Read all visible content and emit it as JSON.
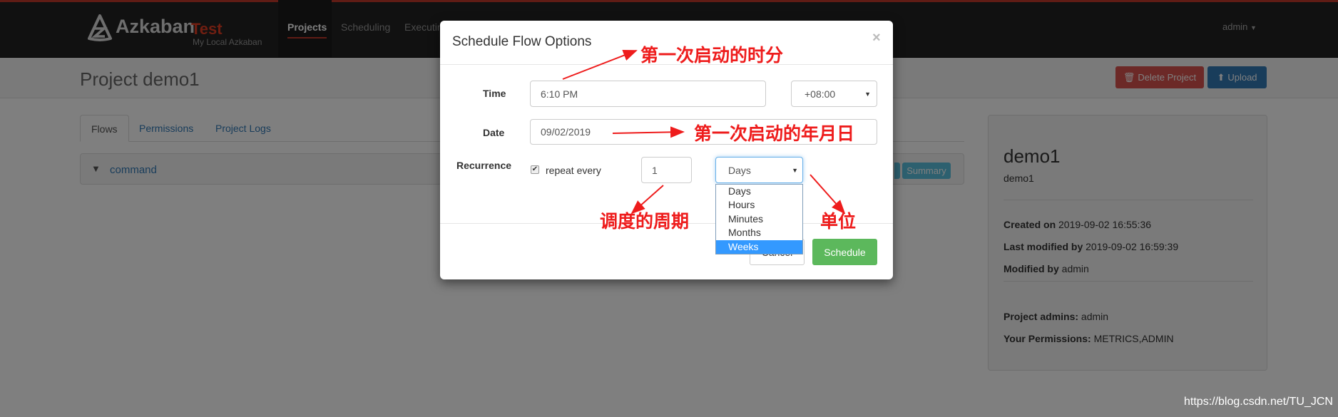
{
  "navbar": {
    "brand": "Azkaban",
    "env": "Test",
    "subtitle": "My Local Azkaban",
    "items": [
      {
        "label": "Projects",
        "active": true
      },
      {
        "label": "Scheduling"
      },
      {
        "label": "Executing"
      }
    ],
    "user": "admin"
  },
  "page": {
    "title": "Project demo1",
    "delete_label": "Delete Project",
    "upload_label": "Upload",
    "tabs": [
      {
        "label": "Flows",
        "active": true
      },
      {
        "label": "Permissions"
      },
      {
        "label": "Project Logs"
      }
    ],
    "flow": {
      "name": "command",
      "summary_label": "Summary"
    }
  },
  "project_info": {
    "name": "demo1",
    "description": "demo1",
    "created_label": "Created on",
    "created": "2019-09-02 16:55:36",
    "lastmod_label": "Last modified by",
    "lastmod": "2019-09-02 16:59:39",
    "modby_label": "Modified by",
    "modby": "admin",
    "admins_label": "Project admins:",
    "admins": "admin",
    "perm_label": "Your Permissions:",
    "perm": "METRICS,ADMIN"
  },
  "modal": {
    "title": "Schedule Flow Options",
    "close": "×",
    "time_label": "Time",
    "time_value": "6:10 PM",
    "timezone": "+08:00",
    "date_label": "Date",
    "date_value": "09/02/2019",
    "recurrence_label": "Recurrence",
    "repeat_label": "repeat every",
    "repeat_checked": true,
    "repeat_value": "1",
    "unit_selected": "Days",
    "unit_options": [
      "Days",
      "Hours",
      "Minutes",
      "Months",
      "Weeks"
    ],
    "unit_highlighted": "Weeks",
    "cancel_label": "Cancel",
    "schedule_label": "Schedule"
  },
  "annotations": {
    "time": "第一次启动的时分",
    "date": "第一次启动的年月日",
    "period": "调度的周期",
    "unit": "单位",
    "color": "#ee1c1c"
  },
  "watermark": "https://blog.csdn.net/TU_JCN",
  "colors": {
    "danger": "#d9534f",
    "primary": "#337ab7",
    "success": "#5cb85c",
    "info": "#5bc0de",
    "brand_red": "#e03c23"
  }
}
